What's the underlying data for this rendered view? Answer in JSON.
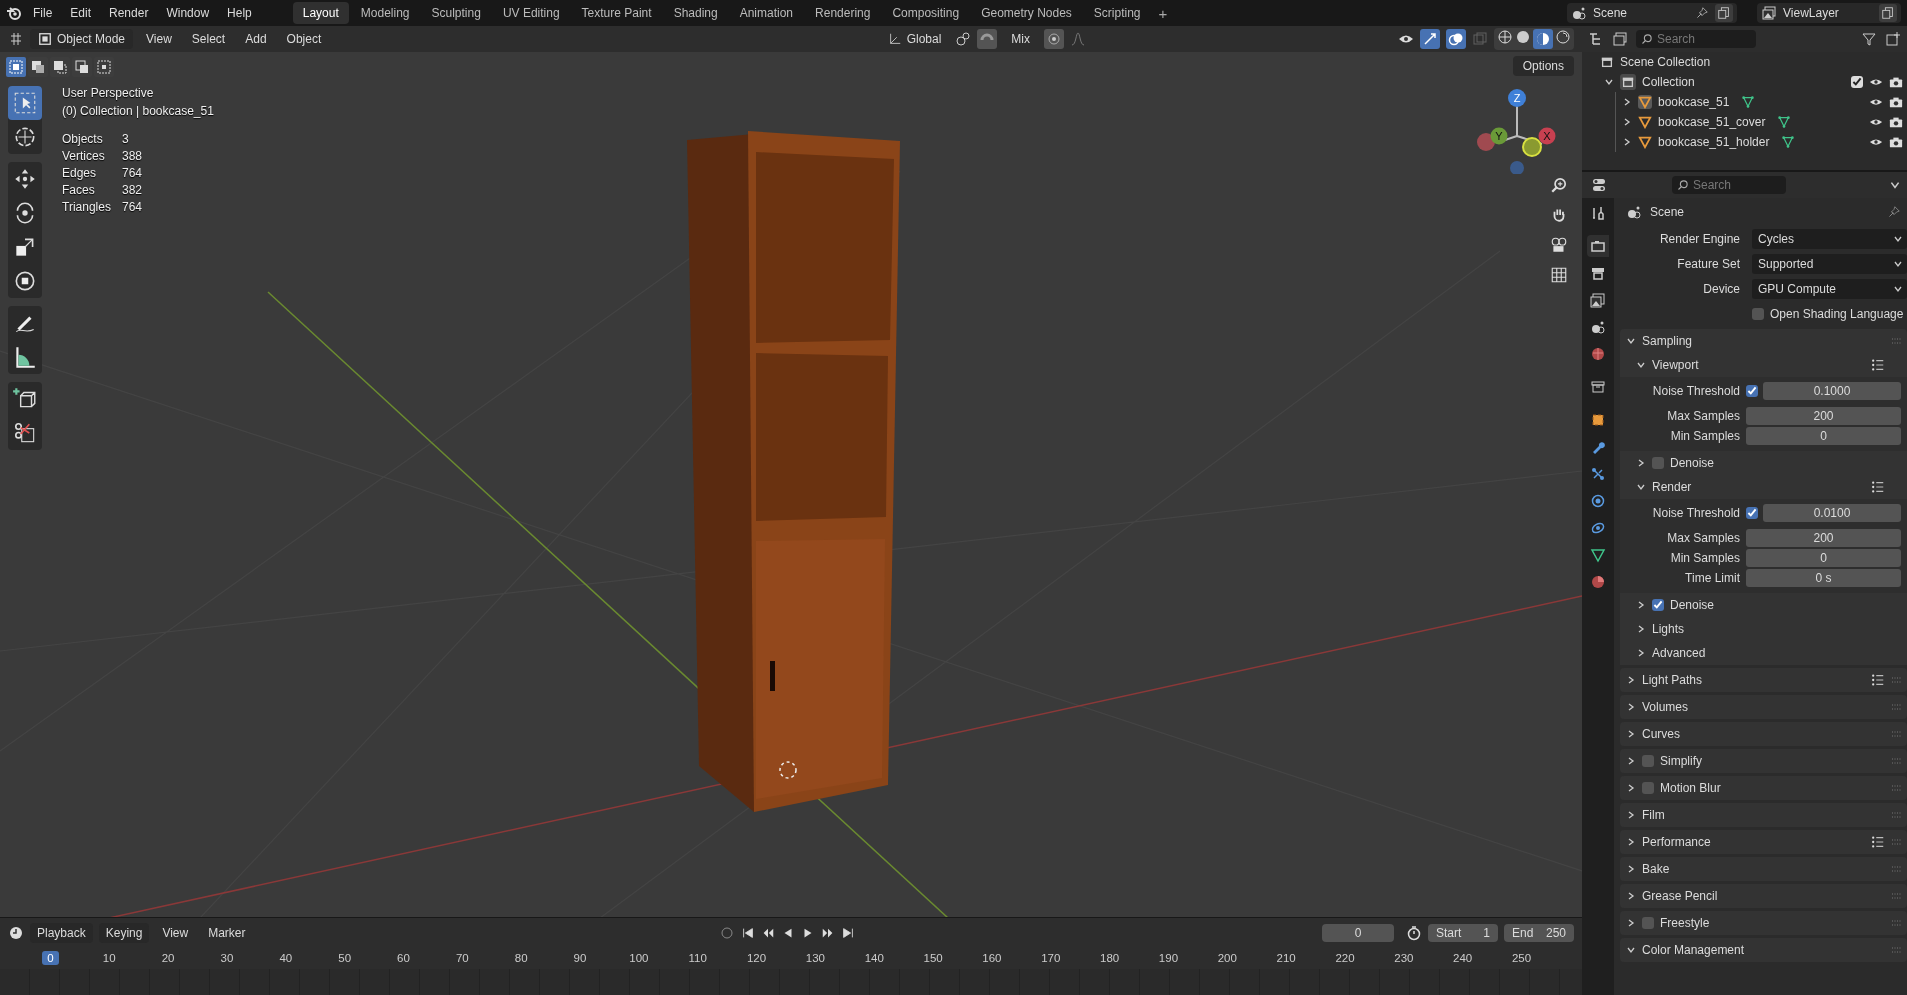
{
  "menu": [
    "File",
    "Edit",
    "Render",
    "Window",
    "Help"
  ],
  "workspaces": [
    {
      "label": "Layout",
      "selected": true
    },
    {
      "label": "Modeling",
      "selected": false
    },
    {
      "label": "Sculpting",
      "selected": false
    },
    {
      "label": "UV Editing",
      "selected": false
    },
    {
      "label": "Texture Paint",
      "selected": false
    },
    {
      "label": "Shading",
      "selected": false
    },
    {
      "label": "Animation",
      "selected": false
    },
    {
      "label": "Rendering",
      "selected": false
    },
    {
      "label": "Compositing",
      "selected": false
    },
    {
      "label": "Geometry Nodes",
      "selected": false
    },
    {
      "label": "Scripting",
      "selected": false
    }
  ],
  "add_workspace": "+",
  "scene": "Scene",
  "view_layer": "ViewLayer",
  "viewport_header": {
    "mode": "Object Mode",
    "menus": [
      "View",
      "Select",
      "Add",
      "Object"
    ],
    "orientation": "Global",
    "snap_mode": "Mix",
    "options": "Options"
  },
  "select_modes": [
    {
      "kind": "set",
      "selected": true
    },
    {
      "kind": "extend",
      "selected": false
    },
    {
      "kind": "subtract",
      "selected": false
    },
    {
      "kind": "invert",
      "selected": false
    },
    {
      "kind": "intersect",
      "selected": false
    }
  ],
  "tool_groups": [
    {
      "tools": [
        {
          "kind": "select",
          "selected": true
        },
        {
          "kind": "cursor",
          "selected": false
        }
      ]
    },
    {
      "tools": [
        {
          "kind": "move",
          "selected": false
        },
        {
          "kind": "rotate",
          "selected": false
        },
        {
          "kind": "scale",
          "selected": false
        },
        {
          "kind": "transform",
          "selected": false
        }
      ]
    },
    {
      "tools": [
        {
          "kind": "annotate",
          "selected": false
        },
        {
          "kind": "measure",
          "selected": false
        }
      ]
    },
    {
      "tools": [
        {
          "kind": "add_cube",
          "selected": false
        },
        {
          "kind": "cut",
          "selected": false
        }
      ]
    }
  ],
  "overlay": {
    "title": "User Perspective",
    "context": "(0) Collection | bookcase_51",
    "stats": [
      {
        "label": "Objects",
        "value": "3"
      },
      {
        "label": "Vertices",
        "value": "388"
      },
      {
        "label": "Edges",
        "value": "764"
      },
      {
        "label": "Faces",
        "value": "382"
      },
      {
        "label": "Triangles",
        "value": "764"
      }
    ]
  },
  "gizmo": {
    "z": "Z",
    "y": "Y",
    "x": "X"
  },
  "outliner": {
    "search_placeholder": "Search",
    "root": "Scene Collection",
    "collection": {
      "label": "Collection",
      "expanded": true,
      "checked": true,
      "children": [
        {
          "label": "bookcase_51",
          "active": true
        },
        {
          "label": "bookcase_51_cover",
          "active": false
        },
        {
          "label": "bookcase_51_holder",
          "active": false
        }
      ]
    }
  },
  "properties": {
    "search_placeholder": "Search",
    "tabs": [
      {
        "kind": "tool",
        "selected": false
      },
      {
        "kind": "render",
        "selected": true
      },
      {
        "kind": "output",
        "selected": false
      },
      {
        "kind": "view_layer",
        "selected": false
      },
      {
        "kind": "scene",
        "selected": false
      },
      {
        "kind": "world",
        "selected": false
      },
      {
        "kind": "collection",
        "selected": false
      },
      {
        "kind": "object",
        "selected": false
      },
      {
        "kind": "modifiers",
        "selected": false
      },
      {
        "kind": "particles",
        "selected": false
      },
      {
        "kind": "physics",
        "selected": false
      },
      {
        "kind": "constraints",
        "selected": false
      },
      {
        "kind": "data",
        "selected": false
      },
      {
        "kind": "material",
        "selected": false
      }
    ],
    "context": "Scene",
    "fields": [
      {
        "label": "Render Engine",
        "value": "Cycles"
      },
      {
        "label": "Feature Set",
        "value": "Supported"
      },
      {
        "label": "Device",
        "value": "GPU Compute"
      }
    ],
    "osl": {
      "label": "Open Shading Language",
      "checked": false
    },
    "sections": [
      {
        "label": "Sampling",
        "expanded": true,
        "items": [
          {
            "label": "Viewport",
            "expanded": true,
            "list_icon": true,
            "rows": [
              {
                "label": "Noise Threshold",
                "value": "0.1000",
                "checked": true
              },
              {
                "label": "Max Samples",
                "value": "200"
              },
              {
                "label": "Min Samples",
                "value": "0"
              }
            ]
          },
          {
            "label": "Denoise",
            "expanded": false,
            "checked": false
          },
          {
            "label": "Render",
            "expanded": true,
            "list_icon": true,
            "rows": [
              {
                "label": "Noise Threshold",
                "value": "0.0100",
                "checked": true
              },
              {
                "label": "Max Samples",
                "value": "200"
              },
              {
                "label": "Min Samples",
                "value": "0"
              },
              {
                "label": "Time Limit",
                "value": "0 s"
              }
            ]
          },
          {
            "label": "Denoise",
            "expanded": false,
            "checked": true
          },
          {
            "label": "Lights",
            "expanded": false
          },
          {
            "label": "Advanced",
            "expanded": false
          }
        ]
      },
      {
        "label": "Light Paths",
        "expanded": false,
        "list_icon": true
      },
      {
        "label": "Volumes",
        "expanded": false
      },
      {
        "label": "Curves",
        "expanded": false
      },
      {
        "label": "Simplify",
        "expanded": false,
        "checked": false
      },
      {
        "label": "Motion Blur",
        "expanded": false,
        "checked": false
      },
      {
        "label": "Film",
        "expanded": false
      },
      {
        "label": "Performance",
        "expanded": false,
        "list_icon": true
      },
      {
        "label": "Bake",
        "expanded": false
      },
      {
        "label": "Grease Pencil",
        "expanded": false
      },
      {
        "label": "Freestyle",
        "expanded": false,
        "checked": false
      },
      {
        "label": "Color Management",
        "expanded": true
      }
    ]
  },
  "timeline": {
    "menus": [
      "Playback",
      "Keying",
      "View",
      "Marker"
    ],
    "current_frame": "0",
    "start": {
      "label": "Start",
      "value": "1"
    },
    "end": {
      "label": "End",
      "value": "250"
    },
    "playhead": "0",
    "ticks": [
      "10",
      "20",
      "30",
      "40",
      "50",
      "60",
      "70",
      "80",
      "90",
      "100",
      "110",
      "120",
      "130",
      "140",
      "150",
      "160",
      "170",
      "180",
      "190",
      "200",
      "210",
      "220",
      "230",
      "240",
      "250"
    ]
  }
}
